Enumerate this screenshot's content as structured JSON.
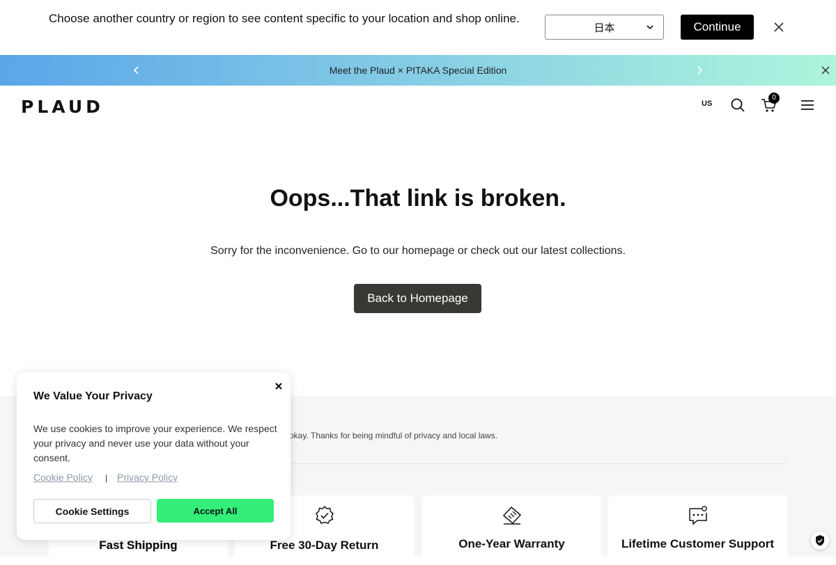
{
  "region_bar": {
    "message": "Choose another country or region to see content specific to your location and shop online.",
    "selected_region": "日本",
    "continue_label": "Continue"
  },
  "promo_bar": {
    "text": "Meet the Plaud × PITAKA Special Edition"
  },
  "header": {
    "logo": "PLAUD",
    "locale": "US",
    "cart_count": "0"
  },
  "main": {
    "title": "Oops...That link is broken.",
    "description": "Sorry for the inconvenience. Go to our homepage or check out our latest collections.",
    "home_button": "Back to Homepage"
  },
  "privacy_notice": {
    "text": "ir okay. Thanks for being mindful of privacy and local laws."
  },
  "features": [
    {
      "label": "Fast Shipping",
      "icon": "truck-icon"
    },
    {
      "label": "Free 30-Day Return",
      "icon": "badge-check-icon"
    },
    {
      "label": "One-Year Warranty",
      "icon": "warranty-tag-icon"
    },
    {
      "label": "Lifetime Customer Support",
      "icon": "chat-support-icon"
    }
  ],
  "cookie_banner": {
    "title": "We Value Your Privacy",
    "text": "We use cookies to improve your experience. We respect your privacy and never use your data without your consent.",
    "cookie_policy": "Cookie Policy",
    "separator": "|",
    "privacy_policy": "Privacy Policy",
    "settings_label": "Cookie Settings",
    "accept_label": "Accept All"
  },
  "colors": {
    "accept_green": "#33ef7a",
    "home_button": "#3a3835",
    "promo_gradient_start": "#5aa6e8",
    "promo_gradient_end": "#aef5dc"
  }
}
